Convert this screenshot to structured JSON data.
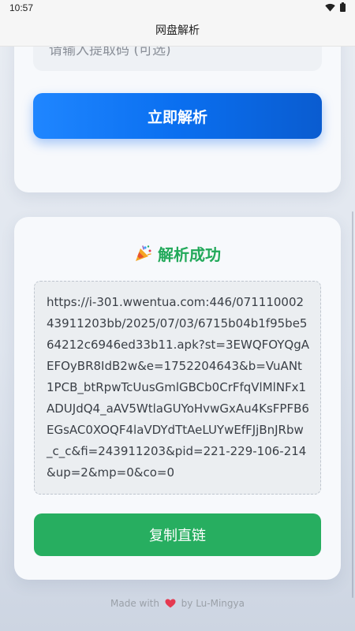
{
  "status_bar": {
    "time": "10:57"
  },
  "app_bar": {
    "title": "网盘解析"
  },
  "form": {
    "code_placeholder": "请输入提取码 (可选)",
    "parse_label": "立即解析"
  },
  "result": {
    "title": "解析成功",
    "link": "https://i-301.wwentua.com:446/07111000243911203bb/2025/07/03/6715b04b1f95be564212c6946ed33b11.apk?st=3EWQFOYQgAEFOyBR8IdB2w&e=1752204643&b=VuANt1PCB_btRpwTcUusGmlGBCb0CrFfqVlMlNFx1ADUJdQ4_aAV5WtlaGUYoHvwGxAu4KsFPFB6EGsAC0XOQF4laVDYdTtAeLUYwEfFJjBnJRbw_c_c&fi=243911203&pid=221-229-106-214&up=2&mp=0&co=0",
    "copy_label": "复制直链"
  },
  "footer": {
    "prefix": "Made with",
    "suffix": "by Lu-Mingya"
  },
  "colors": {
    "primary_blue": "#0a6ff0",
    "success_green": "#27ae60",
    "heart_red": "#e53950"
  },
  "icons": {
    "wifi": "wifi-icon",
    "battery": "battery-icon",
    "party": "party-popper-icon",
    "heart": "heart-icon"
  }
}
